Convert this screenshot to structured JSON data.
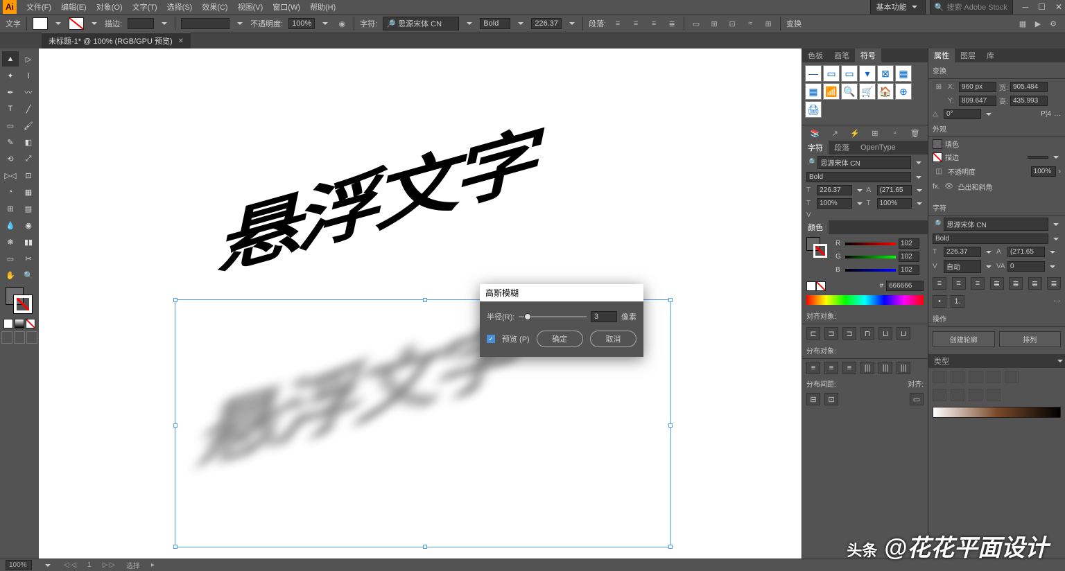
{
  "app_logo": "Ai",
  "menu": [
    "文件(F)",
    "编辑(E)",
    "对象(O)",
    "文字(T)",
    "选择(S)",
    "效果(C)",
    "视图(V)",
    "窗口(W)",
    "帮助(H)"
  ],
  "workspace": "基本功能",
  "search_placeholder": "搜索 Adobe Stock",
  "ctrl": {
    "type_label": "文字",
    "stroke_label": "描边:",
    "opacity_label": "不透明度:",
    "opacity_val": "100%",
    "char_label": "字符:",
    "font": "思源宋体 CN",
    "weight": "Bold",
    "size": "226.37",
    "para_label": "段落:",
    "transform_label": "变换"
  },
  "doc_tab": "未标题-1* @ 100% (RGB/GPU 预览)",
  "canvas_text": "悬浮文字",
  "dialog": {
    "title": "高斯模糊",
    "radius_label": "半径(R):",
    "radius_val": "3",
    "unit": "像素",
    "preview": "预览 (P)",
    "ok": "确定",
    "cancel": "取消"
  },
  "panels": {
    "p1_tabs": [
      "色板",
      "画笔",
      "符号"
    ],
    "char_tab": "字符",
    "para_tab": "段落",
    "ot_tab": "OpenType",
    "font": "思源宋体 CN",
    "weight": "Bold",
    "size": "226.37",
    "leading": "(271.65",
    "hscale": "100%",
    "vscale": "100%",
    "color_tab": "颜色",
    "r": "102",
    "g": "102",
    "b": "102",
    "hex": "666666",
    "align_label": "对齐对象:",
    "dist_label": "分布对象:",
    "spacing_label": "分布间距:",
    "align_to": "对齐:",
    "prop_tab": "属性",
    "layers_tab": "图层",
    "lib_tab": "库",
    "transform_tab": "变换",
    "x": "960 px",
    "w": "905.484",
    "y": "809.647",
    "h": "435.993",
    "angle": "0°",
    "appearance": "外观",
    "fill": "填色",
    "stroke": "描边",
    "opacity": "不透明度",
    "opacity_v": "100%",
    "fx": "fx.",
    "round": "凸出和斜角",
    "char2_tab": "字符",
    "auto": "自动",
    "kern": "0",
    "ops_tab": "操作",
    "new_action": "创建轮廓",
    "arrange": "排列",
    "type_tab": "类型"
  },
  "status": {
    "zoom": "100%",
    "page": "1",
    "mode": "选择"
  },
  "watermark": "头条 @花花平面设计"
}
